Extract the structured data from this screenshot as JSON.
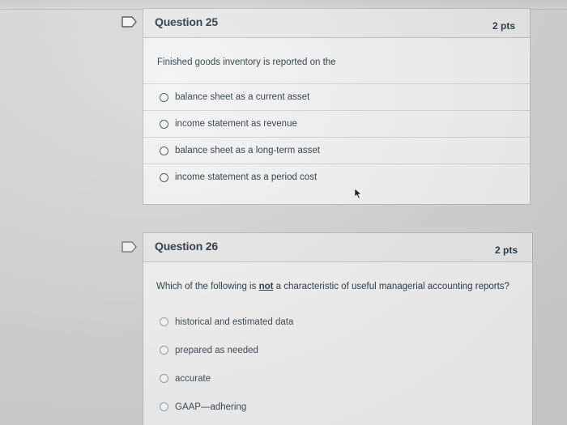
{
  "questions": [
    {
      "title": "Question 25",
      "points": "2 pts",
      "text": "Finished goods inventory is reported on the",
      "answers": [
        "balance sheet as a current asset",
        "income statement as revenue",
        "balance sheet as a long-term asset",
        "income statement as a period cost"
      ]
    },
    {
      "title": "Question 26",
      "points": "2 pts",
      "text_before": "Which of the following is ",
      "text_emphasis": "not",
      "text_after": " a characteristic of useful managerial accounting reports?",
      "answers": [
        "historical and estimated data",
        "prepared as needed",
        "accurate",
        "GAAP—adhering"
      ]
    }
  ],
  "icons": {
    "flag": "flag-icon",
    "radio": "radio-button",
    "cursor": "mouse-pointer-icon"
  },
  "colors": {
    "text": "#2d3b45",
    "card_background": "#f2f2f2",
    "header_background": "#e9e9e9",
    "page_background": "#d6d6d6"
  }
}
